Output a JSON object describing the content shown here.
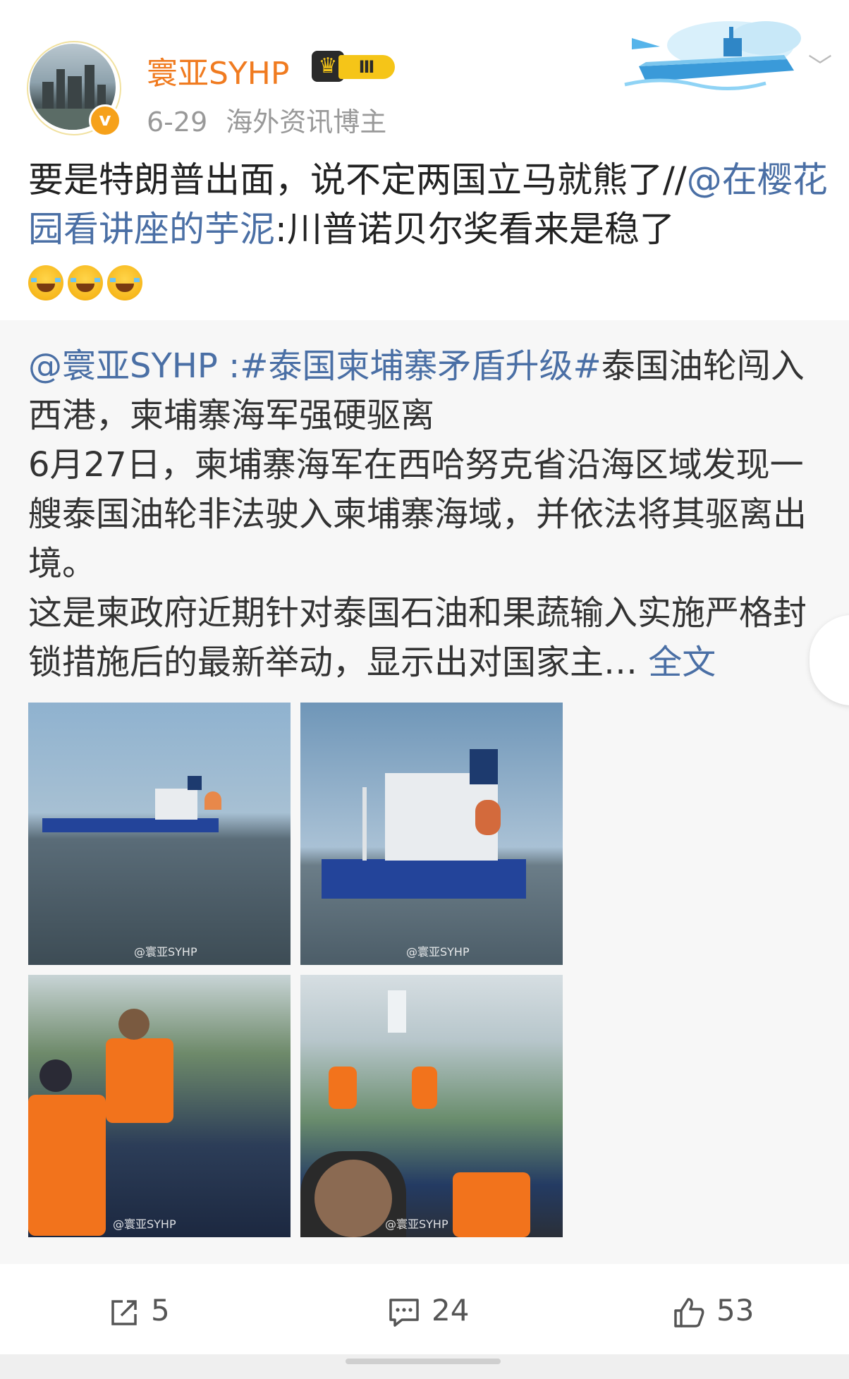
{
  "header": {
    "username": "寰亚SYHP",
    "level_badge": "Ⅲ",
    "crown_glyph": "♛",
    "verified_mark": "v",
    "date": "6-29",
    "role": "海外资讯博主",
    "chevron": "﹀",
    "accent_color": "#f07b20"
  },
  "post": {
    "text": "要是特朗普出面，说不定两国立马就熊了//",
    "mention": "@在樱花园看讲座的芋泥",
    "after_mention": ":川普诺贝尔奖看来是稳了",
    "emoji_count": 3,
    "emoji_name": "laugh-crying"
  },
  "repost": {
    "mention": "@寰亚SYHP",
    "hashtag": " :#泰国柬埔寨矛盾升级#",
    "line1": "泰国油轮闯入西港，柬埔寨海军强硬驱离",
    "line2": "6月27日，柬埔寨海军在西哈努克省沿海区域发现一艘泰国油轮非法驶入柬埔寨海域，并依法将其驱离出境。",
    "line3": "这是柬政府近期针对泰国石油和果蔬输入实施严格封锁措施后的最新举动，显示出对国家主…",
    "full_text_link": " 全文",
    "images": [
      {
        "watermark": "@寰亚SYHP"
      },
      {
        "watermark": "@寰亚SYHP"
      },
      {
        "watermark": "@寰亚SYHP"
      },
      {
        "watermark": "@寰亚SYHP"
      }
    ]
  },
  "actions": {
    "repost_count": "5",
    "comment_count": "24",
    "like_count": "53"
  }
}
